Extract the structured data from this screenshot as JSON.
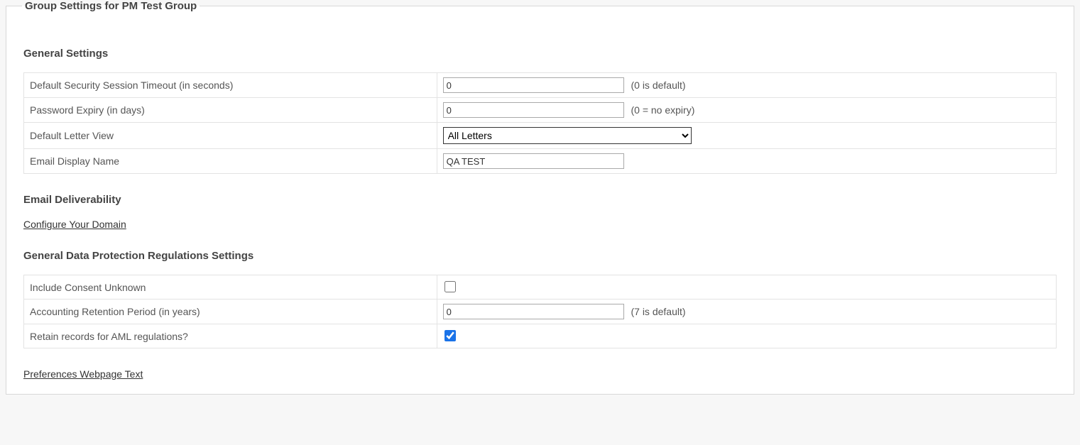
{
  "panel": {
    "legend": "Group Settings for PM Test Group"
  },
  "general": {
    "heading": "General Settings",
    "rows": {
      "session_timeout": {
        "label": "Default Security Session Timeout (in seconds)",
        "value": "0",
        "hint": "(0 is default)"
      },
      "password_expiry": {
        "label": "Password Expiry (in days)",
        "value": "0",
        "hint": "(0 = no expiry)"
      },
      "default_letter_view": {
        "label": "Default Letter View",
        "selected": "All Letters"
      },
      "email_display_name": {
        "label": "Email Display Name",
        "value": "QA TEST"
      }
    }
  },
  "email_deliverability": {
    "heading": "Email Deliverability",
    "link_label": "Configure Your Domain"
  },
  "gdpr": {
    "heading": "General Data Protection Regulations Settings",
    "rows": {
      "include_consent_unknown": {
        "label": "Include Consent Unknown",
        "checked": false
      },
      "accounting_retention": {
        "label": "Accounting Retention Period (in years)",
        "value": "0",
        "hint": "(7 is default)"
      },
      "retain_aml": {
        "label": "Retain records for AML regulations?",
        "checked": true
      }
    }
  },
  "preferences_link": {
    "label": "Preferences Webpage Text"
  }
}
